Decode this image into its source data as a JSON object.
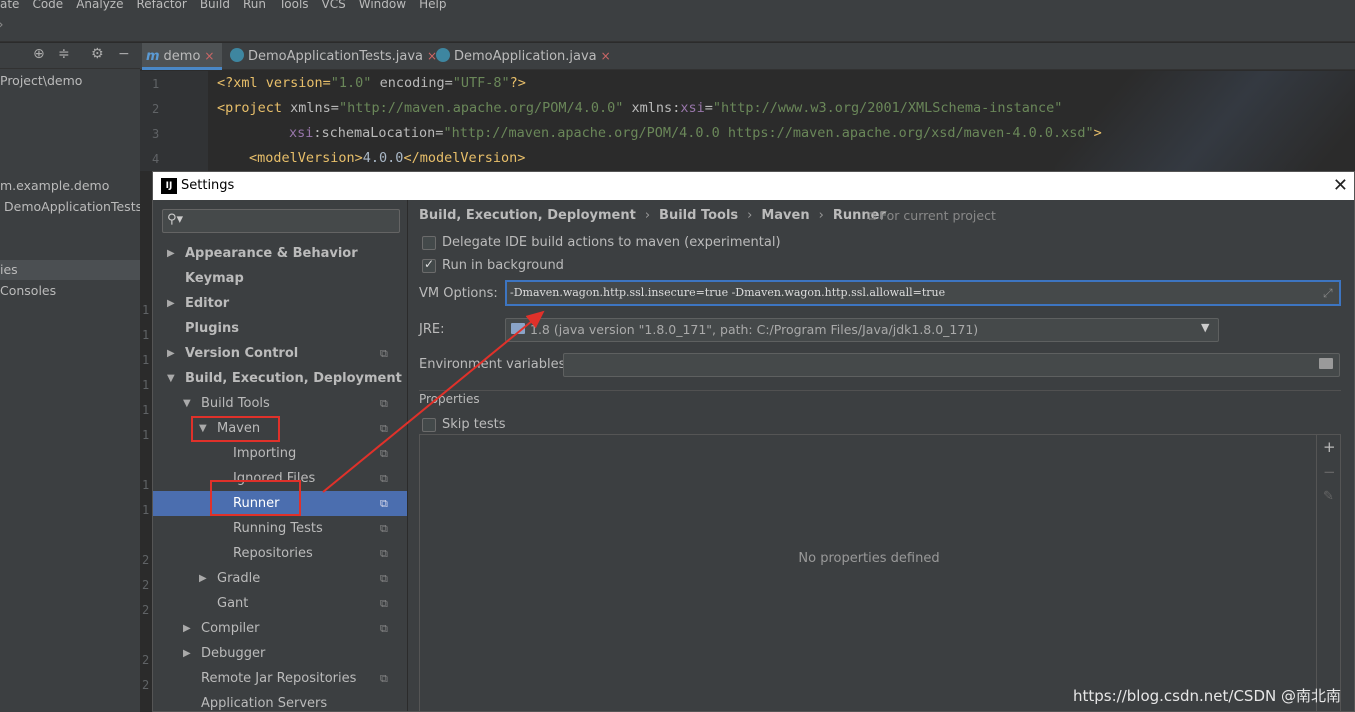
{
  "ide": {
    "menu": [
      "ate",
      "Code",
      "Analyze",
      "Refactor",
      "Build",
      "Run",
      "Tools",
      "VCS",
      "Window",
      "Help"
    ],
    "project_path": "Project\\demo",
    "project_items": [
      "m.example.demo",
      "DemoApplicationTests",
      "ies",
      "Consoles"
    ],
    "tabs": [
      {
        "label": "demo",
        "active": true
      },
      {
        "label": "DemoApplicationTests.java",
        "active": false
      },
      {
        "label": "DemoApplication.java",
        "active": false
      }
    ],
    "line_numbers": [
      "1",
      "2",
      "3",
      "4"
    ],
    "gutter_fragments": [
      "1",
      "1",
      "1",
      "1",
      "1",
      "1",
      "1",
      "1",
      "2",
      "2",
      "2",
      "2",
      "2"
    ]
  },
  "code": {
    "line1": {
      "a": "<?xml version=",
      "b": "\"1.0\"",
      "c": " encoding=",
      "d": "\"UTF-8\"",
      "e": "?>"
    },
    "line2": {
      "a": "<project ",
      "b": "xmlns=",
      "c": "\"http://maven.apache.org/POM/4.0.0\"",
      "d": " xmlns:",
      "e": "xsi",
      "f": "=",
      "g": "\"http://www.w3.org/2001/XMLSchema-instance\""
    },
    "line3": {
      "a": "xsi",
      "b": ":schemaLocation=",
      "c": "\"http://maven.apache.org/POM/4.0.0 https://maven.apache.org/xsd/maven-4.0.0.xsd\"",
      "d": ">"
    },
    "line4": {
      "a": "<modelVersion>",
      "b": "4.0.0",
      "c": "</modelVersion>"
    }
  },
  "dialog": {
    "title": "Settings",
    "logo": "IJ",
    "close": "✕",
    "search_icon": "🔍",
    "tree": {
      "appearance": "Appearance & Behavior",
      "keymap": "Keymap",
      "editor": "Editor",
      "plugins": "Plugins",
      "version_control": "Version Control",
      "build": "Build, Execution, Deployment",
      "build_tools": "Build Tools",
      "maven": "Maven",
      "importing": "Importing",
      "ignored_files": "Ignored Files",
      "runner": "Runner",
      "running_tests": "Running Tests",
      "repositories": "Repositories",
      "gradle": "Gradle",
      "gant": "Gant",
      "compiler": "Compiler",
      "debugger": "Debugger",
      "remote_jar": "Remote Jar Repositories",
      "app_servers": "Application Servers"
    },
    "breadcrumb": [
      "Build, Execution, Deployment",
      "Build Tools",
      "Maven",
      "Runner"
    ],
    "breadcrumb_sep": "›",
    "scope": "For current project",
    "delegate_label": "Delegate IDE build actions to maven (experimental)",
    "delegate_checked": false,
    "background_label": "Run in background",
    "background_checked": true,
    "vm_label": "VM Options:",
    "vm_value": "-Dmaven.wagon.http.ssl.insecure=true -Dmaven.wagon.http.ssl.allowall=true",
    "jre_label": "JRE:",
    "jre_value": "1.8 (java version \"1.8.0_171\", path: C:/Program Files/Java/jdk1.8.0_171)",
    "env_label": "Environment variables:",
    "env_value": "",
    "properties_label": "Properties",
    "skip_tests_label": "Skip tests",
    "skip_tests_checked": false,
    "no_properties": "No properties defined",
    "add": "+",
    "remove": "−",
    "edit": "✎"
  },
  "watermark": "https://blog.csdn.net/CSDN @南北南"
}
